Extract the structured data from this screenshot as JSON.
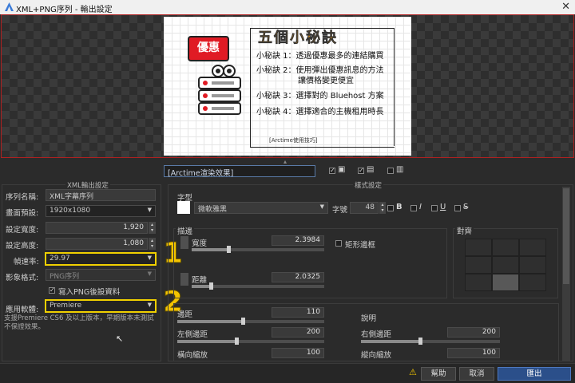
{
  "window": {
    "title": "XML+PNG序列 - 輸出設定",
    "close": "✕"
  },
  "preview": {
    "headline": "五個小秘訣",
    "badge": "優惠",
    "tips": [
      "小秘訣 1：透過優惠最多的連結購買",
      "小秘訣 2：使用彈出優惠訊息的方法",
      "讓價格變更便宜",
      "小秘訣 3：選擇對的 Bluehost 方案",
      "小秘訣 4：選擇適合的主機租用時長"
    ],
    "watermark": "[Arctime使用技巧]"
  },
  "toolbar": {
    "effect_name": "[Arctime渲染效果]"
  },
  "left": {
    "group_title": "XML輸出設定",
    "sequence_name_label": "序列名稱:",
    "sequence_name_value": "XML字幕序列",
    "preset_label": "畫面預設:",
    "preset_value": "1920x1080",
    "width_label": "設定寬度:",
    "width_value": "1,920",
    "height_label": "設定高度:",
    "height_value": "1,080",
    "fps_label": "幀速率:",
    "fps_value": "29.97",
    "format_label": "影象格式:",
    "format_value": "PNG序列",
    "write_png_label": "寫入PNG後設資料",
    "app_label": "應用軟體:",
    "app_value": "Premiere",
    "note": "支援Premiere CS6 及以上版本，早期版本未測試不保證效果。",
    "marker1": "1",
    "marker2": "2"
  },
  "right": {
    "group_title": "樣式設定",
    "font_section": "字型",
    "font_value": "微軟雅黑",
    "size_label": "字號",
    "size_value": "48",
    "bold": "B",
    "italic": "I",
    "underline": "U",
    "strike": "S",
    "stroke_section": "描邊",
    "stroke_width_label": "寬度",
    "stroke_width_value": "2.3984",
    "rect_border_label": "矩形邊框",
    "shadow_distance_label": "距離",
    "shadow_distance_value": "2.0325",
    "align_section": "對齊",
    "margin_v_label": "邊距",
    "margin_v_value": "110",
    "desc_label": "說明",
    "margin_l_label": "左側邊距",
    "margin_l_value": "200",
    "margin_r_label": "右側邊距",
    "margin_r_value": "200",
    "scale_x_label": "橫向縮放",
    "scale_x_value": "100",
    "scale_y_label": "縱向縮放",
    "scale_y_value": "100"
  },
  "buttons": {
    "help": "幫助",
    "cancel": "取消",
    "export": "匯出"
  },
  "colors": {
    "accent": "#2b4f8a",
    "highlight": "#f0d000",
    "badge": "#e01b24",
    "headline": "#f39c12"
  },
  "icons": [
    "app-logo-icon",
    "close-icon",
    "image-icon",
    "film-icon",
    "chevron-down-icon",
    "warning-icon",
    "server-icon"
  ]
}
